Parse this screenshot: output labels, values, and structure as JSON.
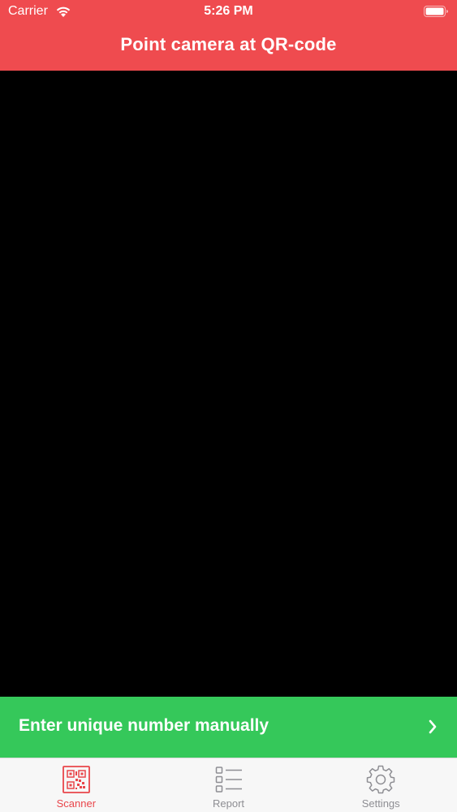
{
  "status_bar": {
    "carrier": "Carrier",
    "time": "5:26 PM",
    "wifi_icon": "wifi-icon",
    "battery_icon": "battery-icon"
  },
  "nav": {
    "title": "Point camera at QR-code"
  },
  "manual_entry": {
    "label": "Enter unique number manually",
    "icon": "chevron-right-icon"
  },
  "tabs": [
    {
      "label": "Scanner",
      "icon": "qr-code-icon",
      "active": true
    },
    {
      "label": "Report",
      "icon": "list-icon",
      "active": false
    },
    {
      "label": "Settings",
      "icon": "gear-icon",
      "active": false
    }
  ],
  "colors": {
    "header": "#ef4b4f",
    "manual_bar": "#35c85a",
    "tab_active": "#e9464b",
    "tab_inactive": "#8e8e93",
    "camera": "#000000"
  }
}
